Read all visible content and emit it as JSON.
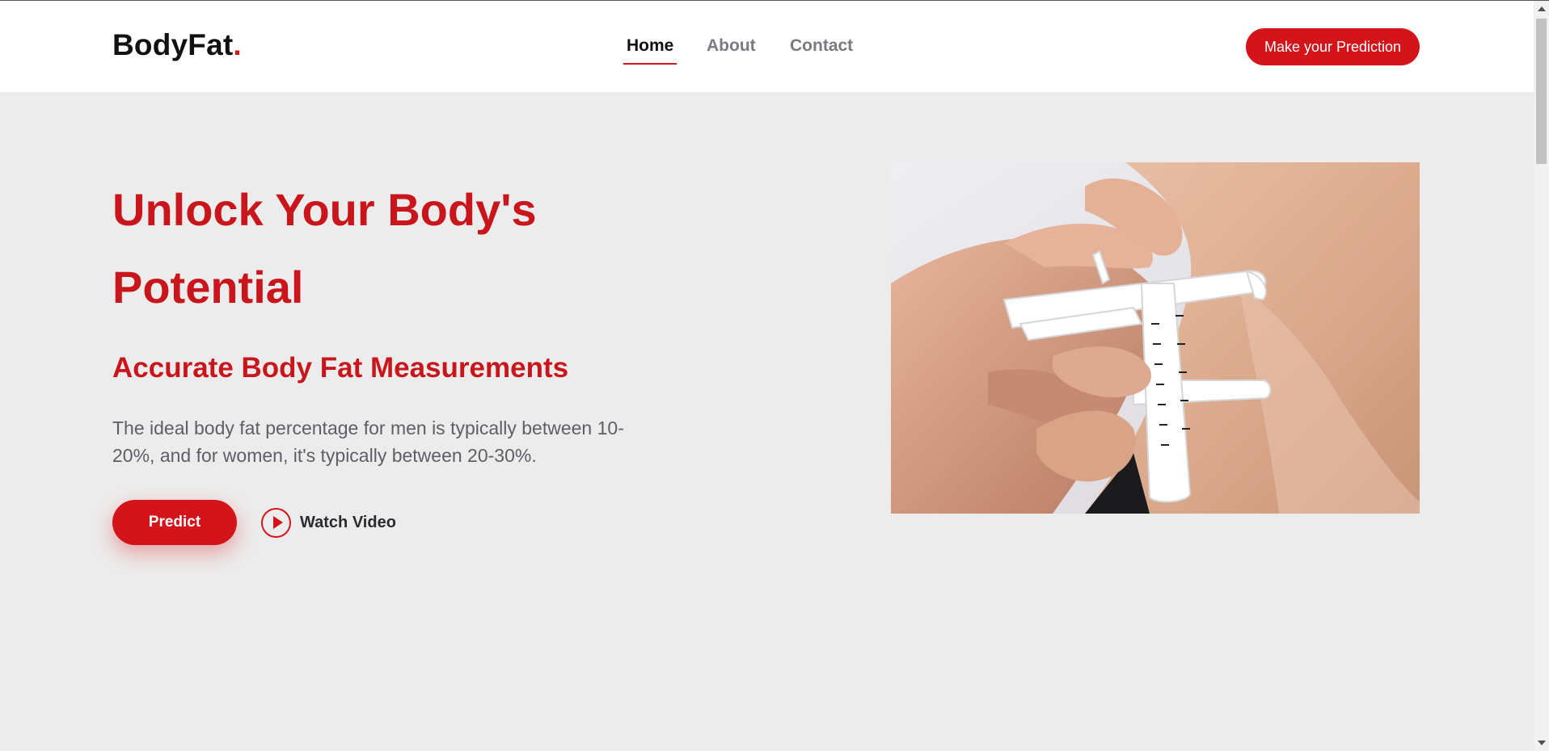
{
  "header": {
    "logo_text": "BodyFat",
    "logo_dot": ".",
    "nav": [
      {
        "label": "Home",
        "active": true
      },
      {
        "label": "About",
        "active": false
      },
      {
        "label": "Contact",
        "active": false
      }
    ],
    "cta_label": "Make your Prediction"
  },
  "hero": {
    "title_line1": "Unlock Your Body's",
    "title_line2": "Potential",
    "subtitle": "Accurate Body Fat Measurements",
    "description": "The ideal body fat percentage for men is typically between 10-20%, and for women, it's typically between 20-30%.",
    "predict_label": "Predict",
    "watch_label": "Watch Video",
    "image_icon": "skinfold-caliper-photo"
  },
  "colors": {
    "accent": "#d3141b",
    "background": "#edecec",
    "header_bg": "#ffffff",
    "text_muted": "#5e5e66"
  }
}
